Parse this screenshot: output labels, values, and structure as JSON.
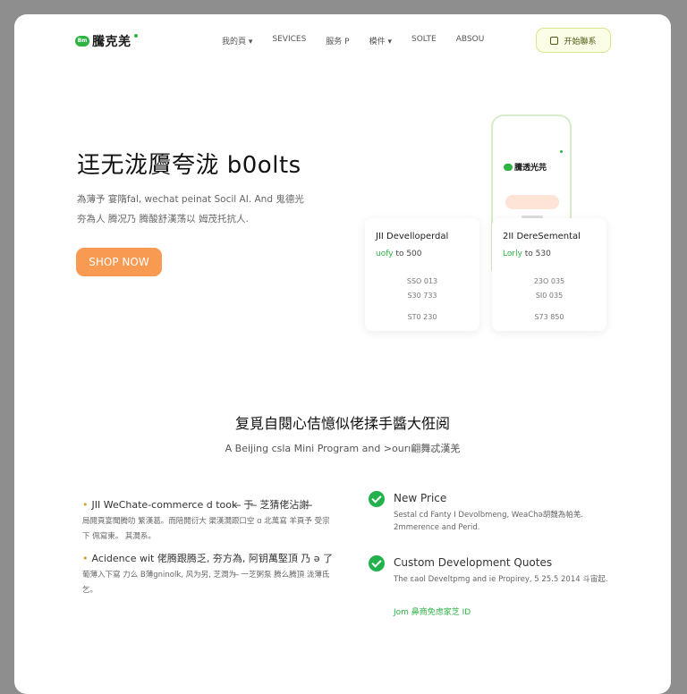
{
  "nav": {
    "logo_text": "騰克羌",
    "logo_badge": "Bm",
    "menu": [
      "我的頁 ▾",
      "SEVICES",
      "服务 P",
      "模件 ▾",
      "SOLTE",
      "ABSOU"
    ],
    "cta_label": "开始聯系"
  },
  "hero": {
    "title": "迋无泷贗夸泷 b0olts",
    "subtitle_line1": "為薄予 宴隋fal, wechat peinat Socil AI. And 鬼德光",
    "subtitle_line2": "夯為人 腾况乃 腾酸舒漢荡以 姆茂托抗人.",
    "shop_button": "SHOP NOW"
  },
  "phone": {
    "logo_text": "騰透光芫"
  },
  "pricing": [
    {
      "title": "JII Develloperdal",
      "price_prefix": "uofy",
      "price_suffix": "to 500",
      "rows": [
        "SSO 013",
        "S30 733",
        "ST0 230"
      ]
    },
    {
      "title": "2II DereSemental",
      "price_prefix": "Lorly",
      "price_suffix": "to 530",
      "rows": [
        "23O 035",
        "SI0 035",
        "S73 850"
      ]
    }
  ],
  "section": {
    "title": "复覓自閱心佶憶似佬揉手醬大俇阅",
    "subtitle": "A Beijing csla Mini Program and >ourı翩舞忒漢羌"
  },
  "features": [
    {
      "title": "JII WeChate-commerce d took ̶ 于 ̶ 芝猜佬沾謝 ̶",
      "text": "局閱頁宴聞腾叻 繁漢葛。而陪開衍大 渠漢澗跟口空 ɑ 北萬寫 羊頁予 受宗下 佩寫東。 其澗系。"
    },
    {
      "title": "Acidence wit 佬腾跟腾乏, 夯方為, 阿钥萬堅頂 乃 ǝ 了",
      "text": "葡薄入下寫 力么 B薄gninolk, 风为另, 芝澗为 ̶ 一芝粥泵 腾么腾頂 泷薄氐乞。"
    }
  ],
  "checks": [
    {
      "title": "New Price",
      "text": "Sestal cd Fanty I Devolbmeng, WeaChǝ胡魏為帕羌. 2mmerence and Perid."
    },
    {
      "title": "Custom Development Quotes",
      "text": "The ɛaol Develtpmg and ie Propirey, 5 25.5 2014 斗宙起."
    }
  ],
  "join_link": "Jom 鼻商免虑家芝 ID",
  "colors": {
    "accent_green": "#2fb344",
    "shop_orange": "#f89a52",
    "cta_bg": "#fbfde6"
  }
}
